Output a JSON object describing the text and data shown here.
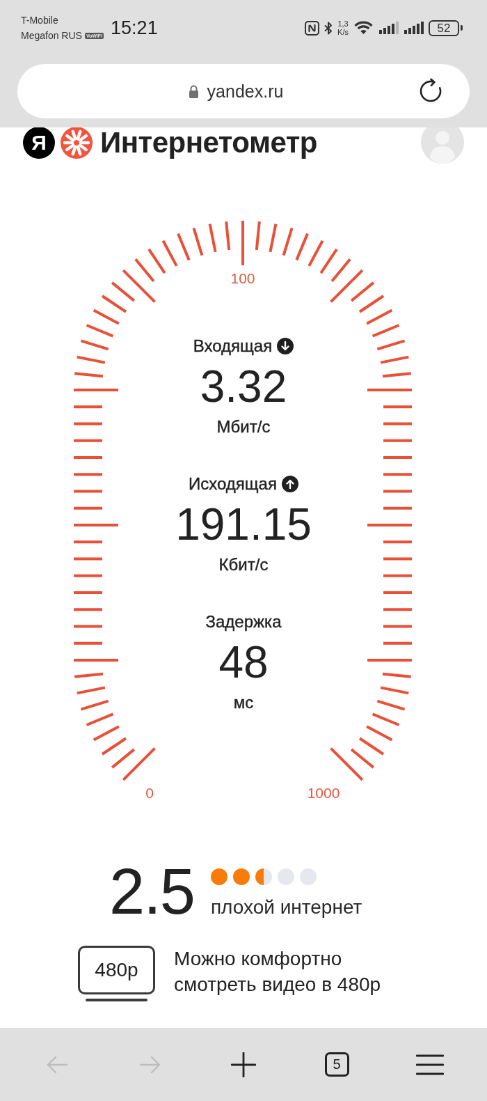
{
  "status_bar": {
    "carriers": [
      {
        "name": "T-Mobile"
      },
      {
        "name": "Megafon RUS",
        "badge": "VoWiFi"
      }
    ],
    "time": "15:21",
    "net_speed": {
      "value": "1,3",
      "unit": "K/s"
    },
    "battery": "52"
  },
  "address_bar": {
    "url": "yandex.ru"
  },
  "header": {
    "logo": "Я",
    "title": "Интернетометр"
  },
  "gauge": {
    "scale_labels": [
      "0",
      "100",
      "1000"
    ]
  },
  "metrics": [
    {
      "kind": "download",
      "label": "Входящая",
      "value": "3.32",
      "unit": "Мбит/с"
    },
    {
      "kind": "upload",
      "label": "Исходящая",
      "value": "191.15",
      "unit": "Кбит/с"
    },
    {
      "kind": "latency",
      "label": "Задержка",
      "value": "48",
      "unit": "мс"
    }
  ],
  "rating": {
    "score": "2.5",
    "stars": 2.5,
    "verdict": "плохой интернет"
  },
  "video": {
    "resolution": "480p",
    "text": "Можно комфортно смотреть видео в 480p"
  },
  "toolbar": [
    {
      "kind": "back",
      "disabled": true
    },
    {
      "kind": "forward",
      "disabled": true
    },
    {
      "kind": "new_tab",
      "disabled": false
    },
    {
      "kind": "tabs",
      "count": "5",
      "disabled": false
    },
    {
      "kind": "menu",
      "disabled": false
    }
  ]
}
